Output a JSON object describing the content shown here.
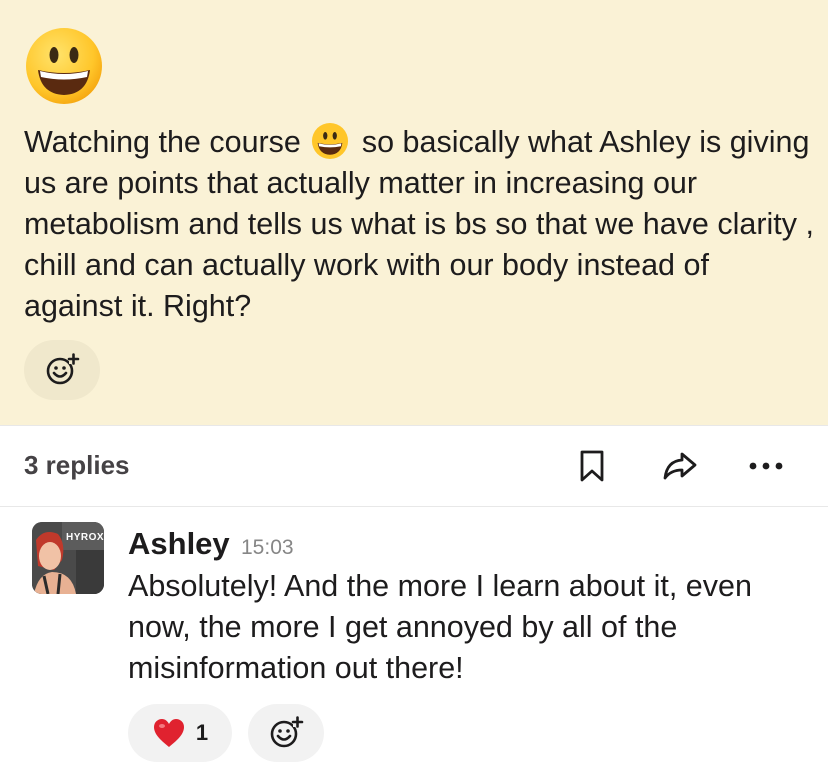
{
  "parent_message": {
    "big_emoji": "grinning-face-emoji",
    "text_before_emoji": "Watching the course",
    "inline_emoji": "grinning-face-emoji",
    "text_after_emoji": "so basically what Ashley is giving us are points that actually matter in increasing our metabolism and tells us what is bs so that we have clarity , chill and can actually work with our body instead of against it. Right?",
    "add_reaction_icon": "add-reaction-icon",
    "background_color": "#faf2d6"
  },
  "replies_bar": {
    "count_label": "3 replies",
    "bookmark_icon": "bookmark-icon",
    "share_icon": "share-forward-icon",
    "more_icon": "more-horizontal-icon"
  },
  "reply": {
    "avatar_brand_text": "HYROX",
    "author": "Ashley",
    "time": "15:03",
    "text": "Absolutely! And the more I learn about it, even now, the more I get annoyed by all of the misinformation out there!",
    "reactions": [
      {
        "emoji": "red-heart-emoji",
        "count": "1"
      }
    ],
    "add_reaction_icon": "add-reaction-icon"
  }
}
